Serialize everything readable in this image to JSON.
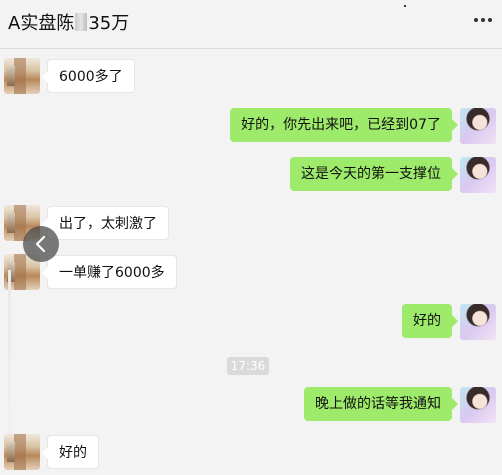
{
  "header": {
    "title_prefix": "A实盘陈",
    "title_suffix": "35万"
  },
  "messages": [
    {
      "side": "left",
      "text": "6000多了"
    },
    {
      "side": "right",
      "text": "好的，你先出来吧，已经到07了"
    },
    {
      "side": "right",
      "text": "这是今天的第一支撑位"
    },
    {
      "side": "left",
      "text": "出了，太刺激了"
    },
    {
      "side": "left",
      "text": "一单赚了6000多"
    },
    {
      "side": "right",
      "text": "好的"
    },
    {
      "side": "right",
      "text": "晚上做的话等我通知"
    },
    {
      "side": "left",
      "text": "好的"
    }
  ],
  "timestamp": "17:36",
  "colors": {
    "sent_bubble": "#9eea6a",
    "received_bubble": "#ffffff",
    "background": "#f3f3f3"
  },
  "icons": {
    "menu": "more-horizontal-icon",
    "back": "chevron-left-icon"
  }
}
